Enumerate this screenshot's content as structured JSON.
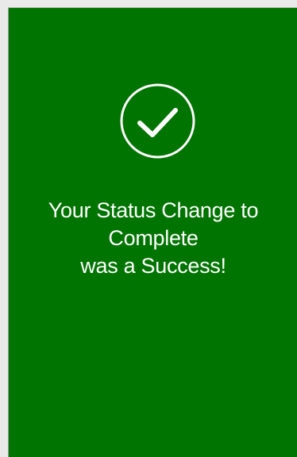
{
  "colors": {
    "panel_background": "#007400",
    "text": "#ffffff",
    "icon": "#ffffff"
  },
  "icon": {
    "name": "check-circle-icon"
  },
  "message": {
    "line1": "Your Status Change to",
    "line2": "Complete",
    "line3": "was a Success!"
  }
}
